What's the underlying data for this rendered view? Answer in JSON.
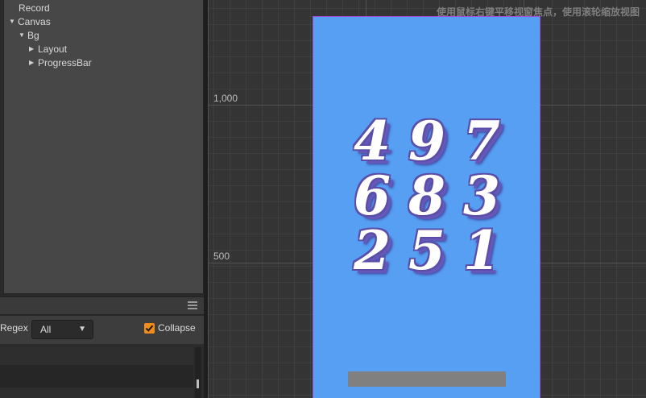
{
  "hierarchy": {
    "items": [
      {
        "label": "Record",
        "arrow": ""
      },
      {
        "label": "Canvas",
        "arrow": "▼"
      },
      {
        "label": "Bg",
        "arrow": "▼"
      },
      {
        "label": "Layout",
        "arrow": "▶"
      },
      {
        "label": "ProgressBar",
        "arrow": "▶"
      }
    ]
  },
  "console": {
    "regex_label": "Regex",
    "level_selected": "All",
    "collapse_label": "Collapse",
    "collapse_checked": true
  },
  "scene": {
    "hint": "使用鼠标右键平移视窗焦点，使用滚轮缩放视图",
    "ruler_labels": [
      "1,000",
      "500"
    ],
    "digits": [
      "4",
      "9",
      "7",
      "6",
      "8",
      "3",
      "2",
      "5",
      "1"
    ],
    "colors": {
      "canvas": "#569ff3",
      "canvas_border": "#a24fd8",
      "progress_bar": "#808080",
      "checkbox": "#f08c1a"
    }
  }
}
